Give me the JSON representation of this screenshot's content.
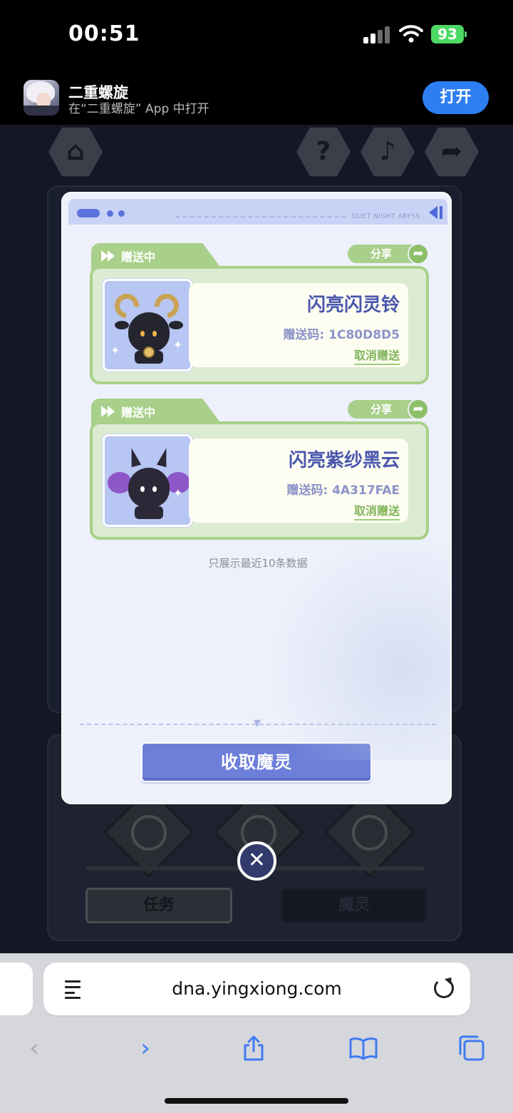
{
  "status_bar": {
    "time": "00:51",
    "battery": "93"
  },
  "app_banner": {
    "app_name": "二重螺旋",
    "subtitle": "在“二重螺旋” App 中打开",
    "open_button": "打开"
  },
  "game_background": {
    "tab_task": "任务",
    "tab_spirit": "魔灵"
  },
  "modal": {
    "header_brand": "DUET NIGHT ABYSS",
    "gifts": [
      {
        "status": "赠送中",
        "share_label": "分享",
        "item_name": "闪亮闪灵铃",
        "gift_code": "赠送码: 1C80D8D5",
        "cancel_label": "取消赠送"
      },
      {
        "status": "赠送中",
        "share_label": "分享",
        "item_name": "闪亮紫纱黑云",
        "gift_code": "赠送码: 4A317FAE",
        "cancel_label": "取消赠送"
      }
    ],
    "footnote": "只展示最近10条数据",
    "collect_button": "收取魔灵"
  },
  "browser": {
    "url": "dna.yingxiong.com"
  }
}
